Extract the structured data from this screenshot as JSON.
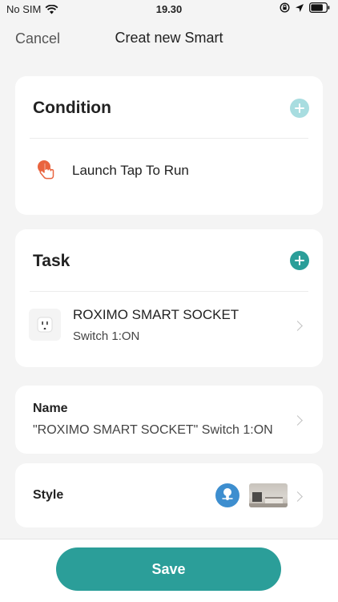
{
  "status_bar": {
    "carrier": "No SIM",
    "time": "19.30"
  },
  "nav": {
    "cancel_label": "Cancel",
    "title": "Creat new Smart"
  },
  "condition": {
    "title": "Condition",
    "items": [
      {
        "label": "Launch Tap To Run",
        "icon": "tap-hand-icon"
      }
    ]
  },
  "task": {
    "title": "Task",
    "items": [
      {
        "device": "ROXIMO SMART SOCKET",
        "action": "Switch 1:ON",
        "icon": "smart-socket-icon"
      }
    ]
  },
  "name_row": {
    "label": "Name",
    "value": "\"ROXIMO SMART SOCKET\" Switch 1:ON"
  },
  "style_row": {
    "label": "Style",
    "icon": "touch-icon",
    "thumbnail": "room-background-thumbnail"
  },
  "footer": {
    "save_label": "Save"
  },
  "colors": {
    "accent": "#2b9e99",
    "accent_light": "#a8dde0",
    "condition_icon": "#e9643f",
    "style_icon": "#3d8ecf"
  }
}
